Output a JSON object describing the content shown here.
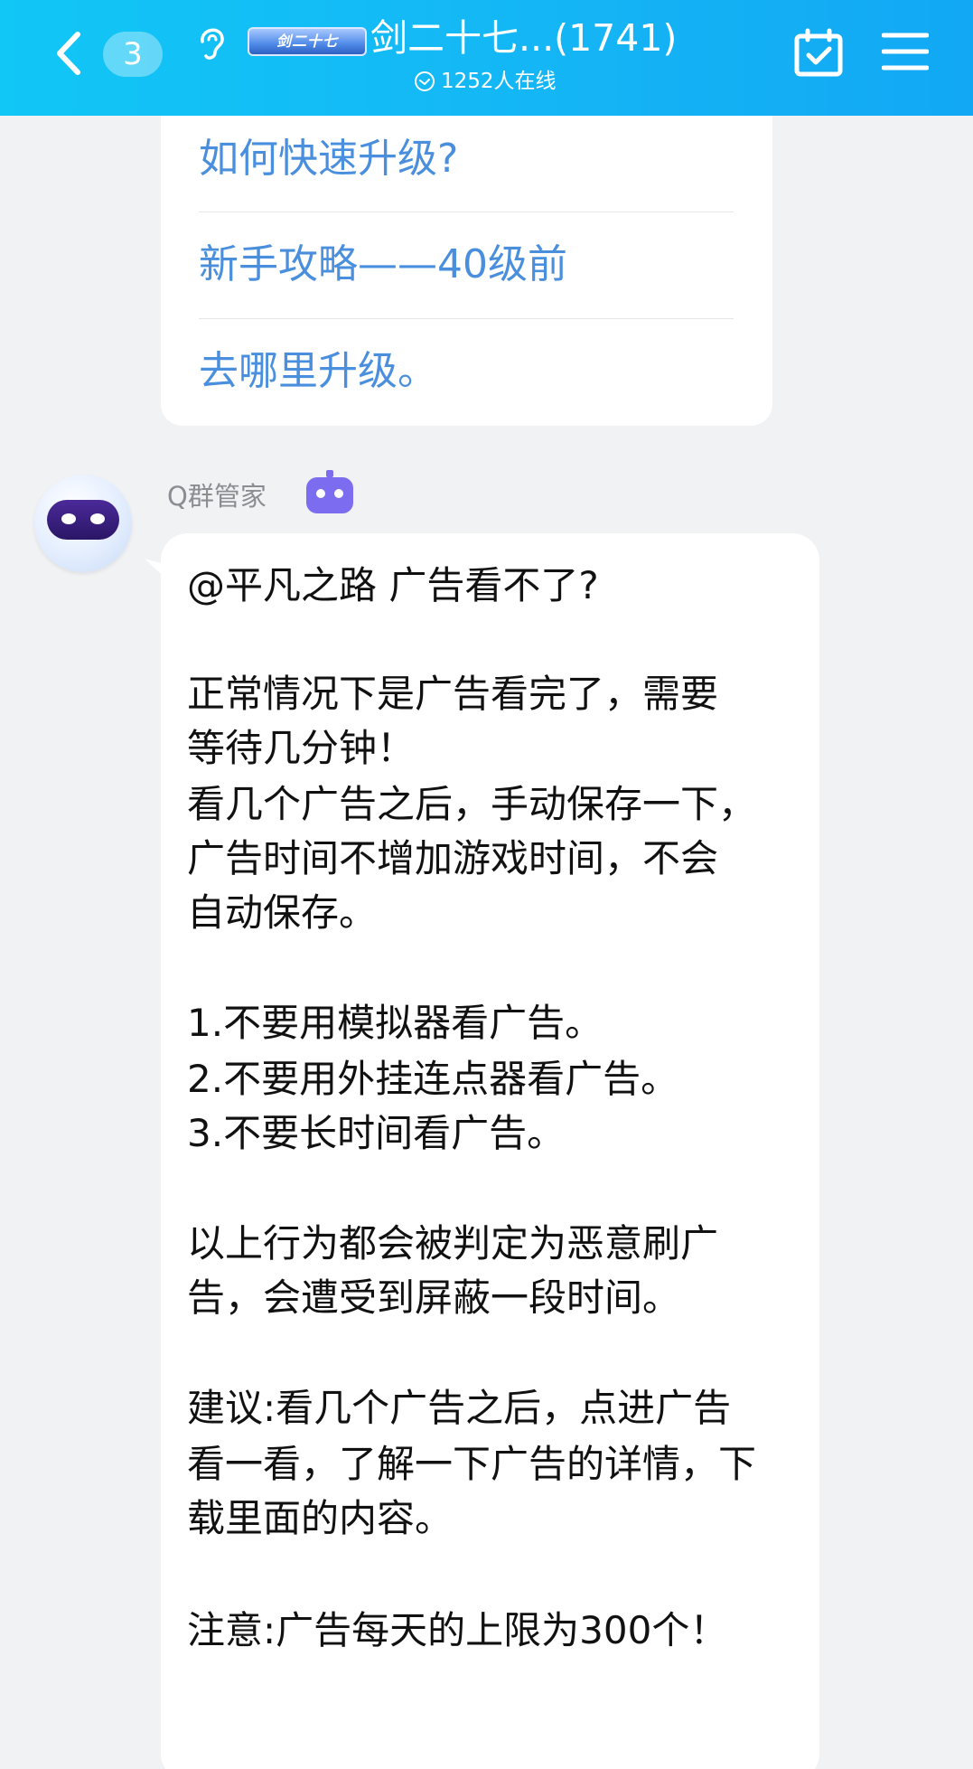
{
  "header": {
    "back_label": "back",
    "unread_count": "3",
    "title_logo_text": "剑二十七",
    "group_title": "剑二十七...(1741)",
    "online_status": "1252人在线"
  },
  "prev_message": {
    "faq_items": [
      "如何快速升级?",
      "新手攻略——40级前",
      "去哪里升级。"
    ]
  },
  "message": {
    "sender": "Q群管家",
    "lines": [
      "@平凡之路 广告看不了?",
      "正常情况下是广告看完了，需要",
      "等待几分钟！",
      "看几个广告之后，手动保存一下，",
      "广告时间不增加游戏时间，不会",
      "自动保存。",
      "1.不要用模拟器看广告。",
      "2.不要用外挂连点器看广告。",
      "3.不要长时间看广告。",
      "以上行为都会被判定为恶意刷广",
      "告，会遭受到屏蔽一段时间。",
      "建议:看几个广告之后，点进广告",
      "看一看，了解一下广告的详情，下",
      "载里面的内容。",
      "注意:广告每天的上限为300个！"
    ]
  },
  "colors": {
    "header_start": "#11c7f6",
    "header_end": "#12a8f4",
    "link": "#4a8fdd",
    "bot_badge": "#7b6cf0",
    "background": "#f1f2f4"
  },
  "icons": [
    "back-chevron-icon",
    "ear-icon",
    "online-check-icon",
    "calendar-check-icon",
    "menu-icon",
    "bot-badge-icon"
  ]
}
